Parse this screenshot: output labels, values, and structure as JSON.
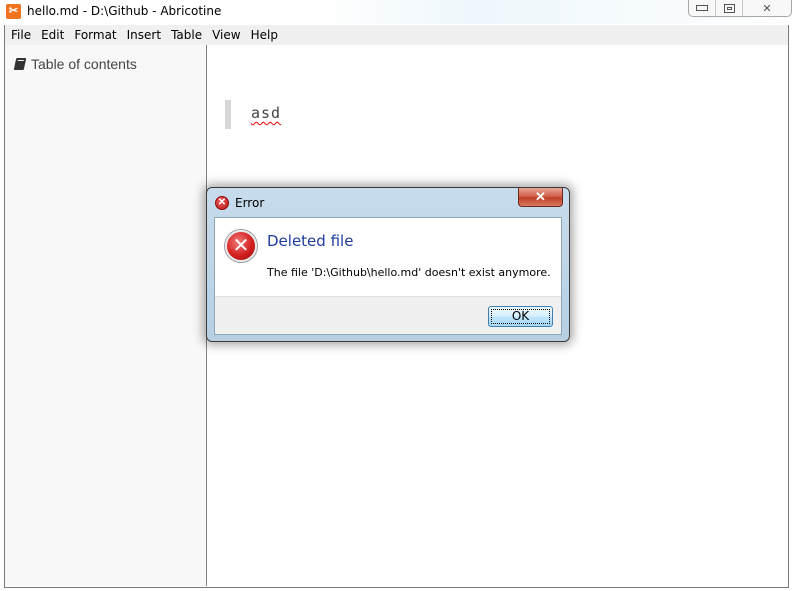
{
  "window": {
    "title": "hello.md - D:\\Github - Abricotine",
    "app_icon": "abricotine-app-icon",
    "caption_buttons": {
      "minimize": "minimize-icon",
      "maximize": "maximize-icon",
      "close": "✕"
    }
  },
  "menu": {
    "items": [
      "File",
      "Edit",
      "Format",
      "Insert",
      "Table",
      "View",
      "Help"
    ]
  },
  "sidebar": {
    "toc_label": "Table of contents",
    "toc_icon": "book-icon"
  },
  "editor": {
    "content": "asd"
  },
  "dialog": {
    "title": "Error",
    "heading": "Deleted file",
    "message": "The file 'D:\\Github\\hello.md' doesn't exist anymore.",
    "ok_label": "OK",
    "close_glyph": "✕",
    "icon_glyph": "✕",
    "icon": "error-icon"
  },
  "colors": {
    "heading": "#1e3ca0",
    "error_red": "#d42020",
    "app_orange": "#f0731f"
  }
}
